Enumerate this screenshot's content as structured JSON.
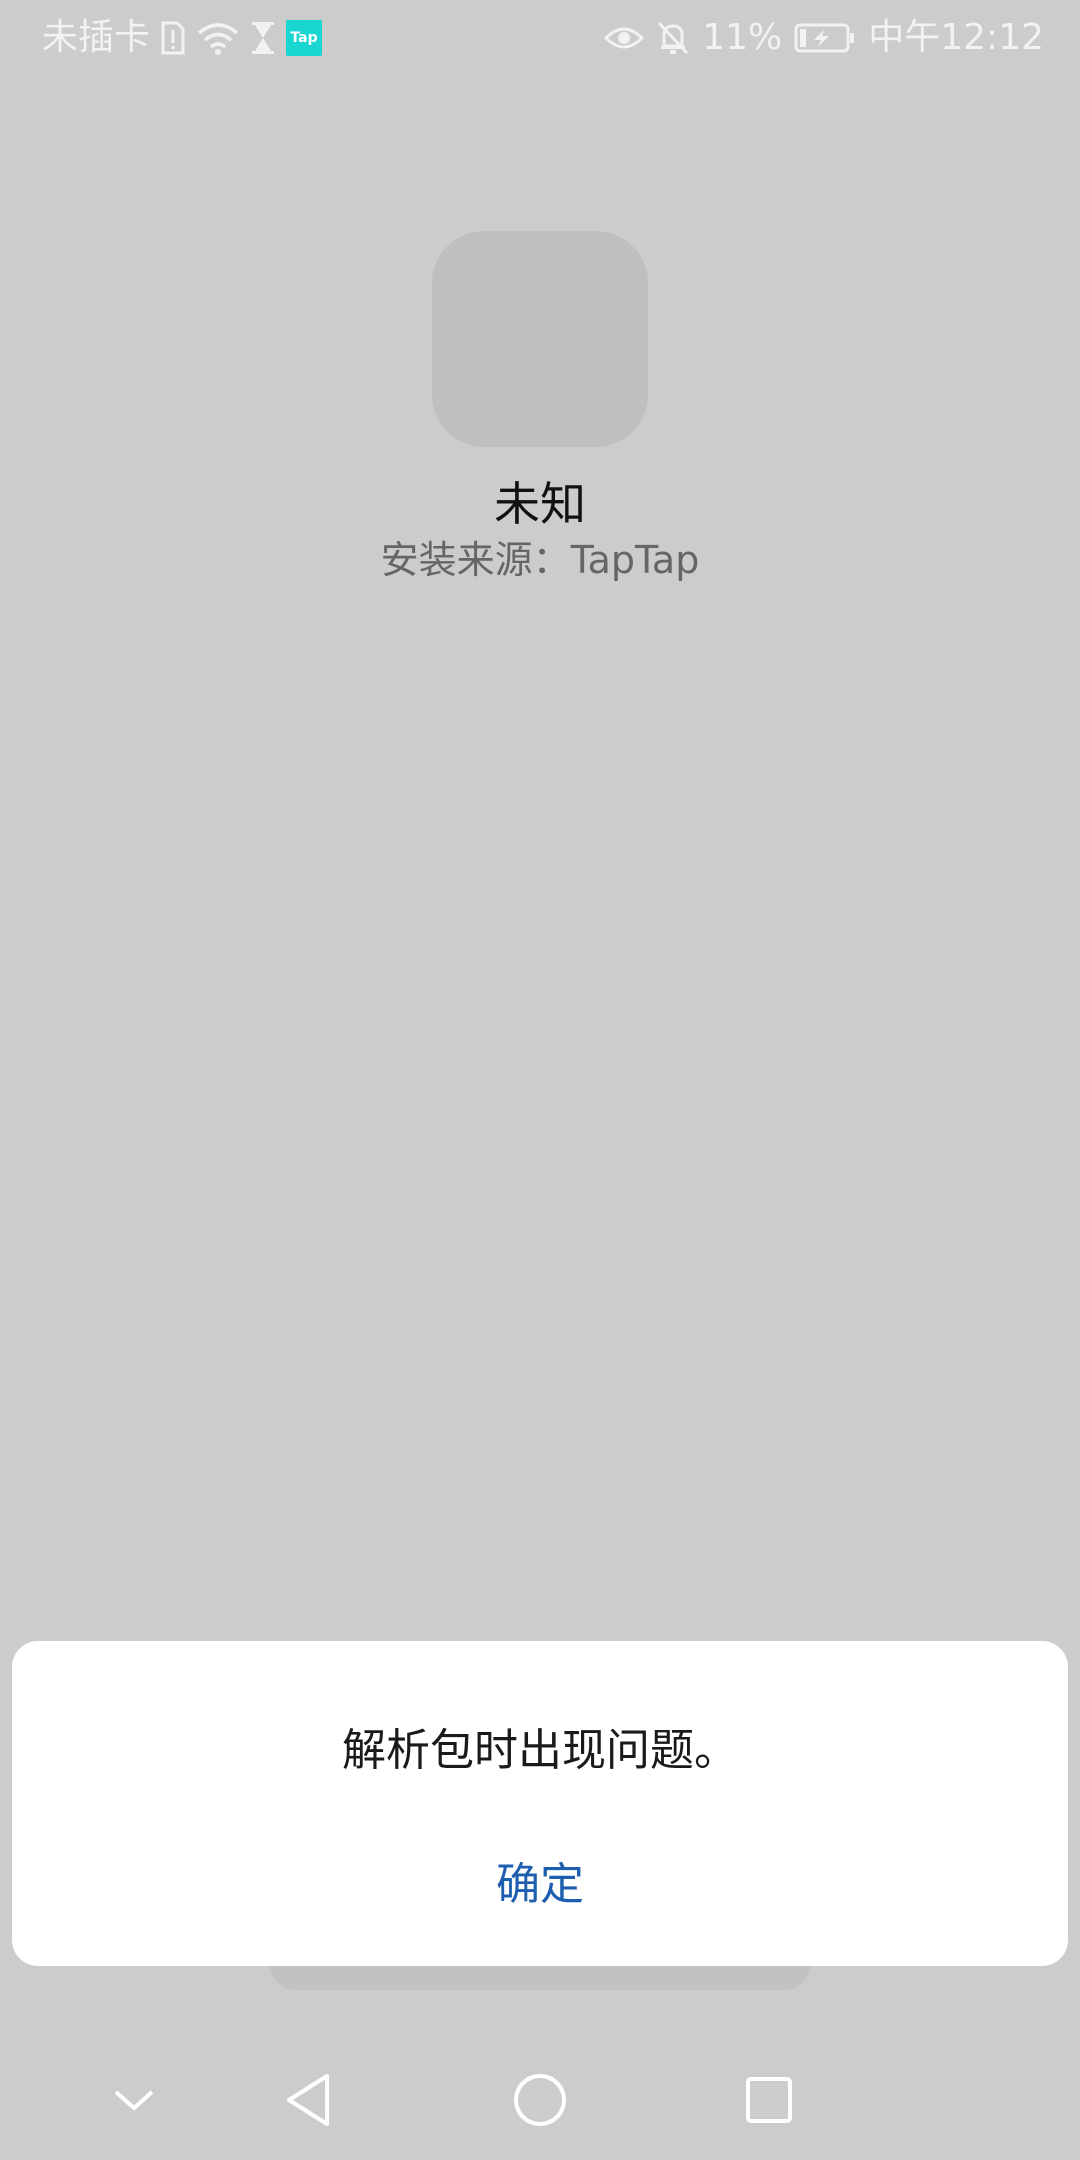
{
  "status_bar": {
    "carrier": "未插卡",
    "battery_percent": "11%",
    "time": "中午12:12",
    "tap_badge": "Tap",
    "icons": [
      "sim-alert-icon",
      "wifi-icon",
      "hourglass-icon",
      "taptap-icon",
      "eye-icon",
      "bell-off-icon",
      "battery-charging-icon"
    ]
  },
  "app": {
    "name": "未知",
    "source": "安装来源：TapTap"
  },
  "dialog": {
    "message": "解析包时出现问题。",
    "ok_label": "确定"
  },
  "nav_bar": {
    "icons": [
      "chevron-down-icon",
      "back-icon",
      "home-icon",
      "recents-icon"
    ]
  },
  "colors": {
    "background": "#cccccc",
    "dialog_background": "#ffffff",
    "accent": "#1d5fae",
    "tap_badge": "#19d6d0"
  }
}
